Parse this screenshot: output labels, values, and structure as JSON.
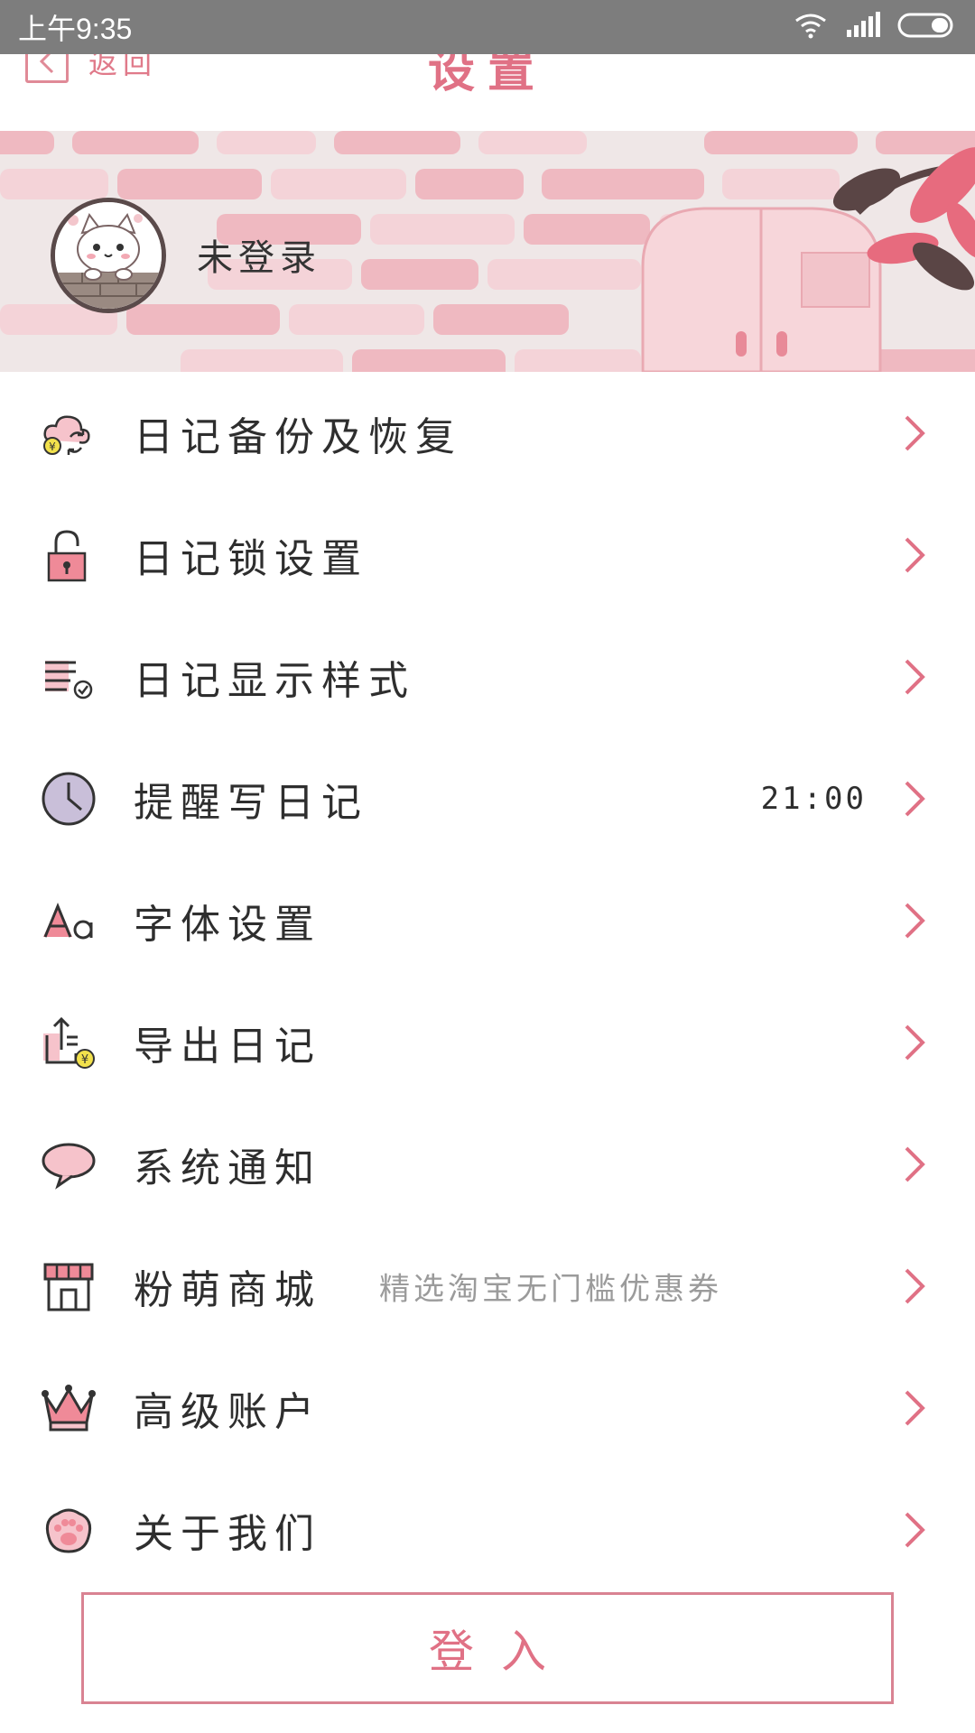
{
  "status_bar": {
    "time": "上午9:35"
  },
  "nav": {
    "back_label": "返回",
    "title": "设置"
  },
  "profile": {
    "user_name": "未登录"
  },
  "settings": [
    {
      "label": "日记备份及恢复",
      "icon": "cloud-backup-icon"
    },
    {
      "label": "日记锁设置",
      "icon": "lock-icon"
    },
    {
      "label": "日记显示样式",
      "icon": "list-style-icon"
    },
    {
      "label": "提醒写日记",
      "icon": "clock-icon",
      "value": "21:00"
    },
    {
      "label": "字体设置",
      "icon": "font-icon"
    },
    {
      "label": "导出日记",
      "icon": "export-icon"
    },
    {
      "label": "系统通知",
      "icon": "speech-bubble-icon"
    },
    {
      "label": "粉萌商城",
      "icon": "shop-icon",
      "sub": "精选淘宝无门槛优惠券"
    },
    {
      "label": "高级账户",
      "icon": "crown-icon"
    },
    {
      "label": "关于我们",
      "icon": "paw-icon"
    }
  ],
  "login": {
    "label": "登入"
  },
  "colors": {
    "accent": "#e07185",
    "brick": "#efb7bf",
    "wall": "#efe7e7"
  }
}
